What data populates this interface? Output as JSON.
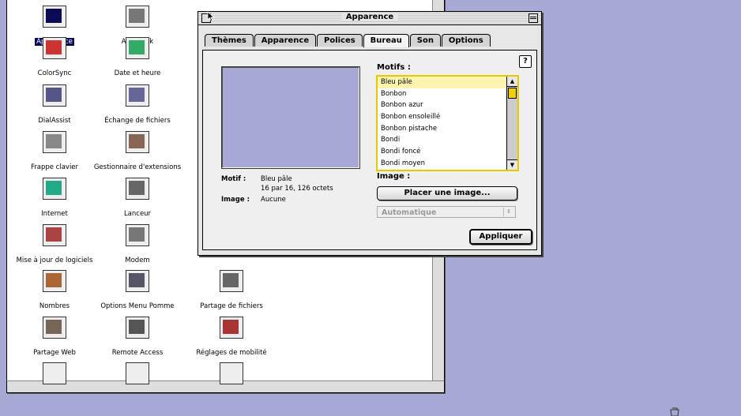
{
  "folder": {
    "icons": [
      {
        "label": "Apparence",
        "icon": "appearance-icon",
        "selected": true
      },
      {
        "label": "AppleTalk",
        "icon": "appletalk-icon"
      },
      {
        "label": "ColorSync",
        "icon": "colorsync-icon"
      },
      {
        "label": "Date et heure",
        "icon": "date-time-icon"
      },
      {
        "label": "DialAssist",
        "icon": "dialassist-icon"
      },
      {
        "label": "Échange de fichiers",
        "icon": "file-exchange-icon"
      },
      {
        "label": "Frappe clavier",
        "icon": "keyboard-icon"
      },
      {
        "label": "Gestionnaire d'extensions",
        "icon": "extensions-manager-icon"
      },
      {
        "label": "Internet",
        "icon": "internet-icon"
      },
      {
        "label": "Lanceur",
        "icon": "launcher-icon"
      },
      {
        "label": "Mise à jour de logiciels",
        "icon": "software-update-icon"
      },
      {
        "label": "Modem",
        "icon": "modem-icon"
      },
      {
        "label": "Nombres",
        "icon": "numbers-icon"
      },
      {
        "label": "Options Menu Pomme",
        "icon": "apple-menu-options-icon"
      },
      {
        "label": "Partage de fichiers",
        "icon": "file-sharing-icon"
      },
      {
        "label": "Partage Web",
        "icon": "web-sharing-icon"
      },
      {
        "label": "Remote Access",
        "icon": "remote-access-icon"
      },
      {
        "label": "Réglages de mobilité",
        "icon": "mobility-icon"
      }
    ]
  },
  "dialog": {
    "title": "Apparence",
    "tabs": [
      "Thèmes",
      "Apparence",
      "Polices",
      "Bureau",
      "Son",
      "Options"
    ],
    "active_tab": "Bureau",
    "motifs_label": "Motifs :",
    "patterns": [
      "Bleu pâle",
      "Bonbon",
      "Bonbon azur",
      "Bonbon ensoleillé",
      "Bonbon pistache",
      "Bondi",
      "Bondi foncé",
      "Bondi moyen"
    ],
    "selected_pattern": "Bleu pâle",
    "info": {
      "motif_key": "Motif :",
      "motif_value": "Bleu pâle",
      "motif_detail": "16 par 16, 126 octets",
      "image_key": "Image :",
      "image_value": "Aucune"
    },
    "image_label": "Image :",
    "place_image_button": "Placer une image...",
    "position_popup": "Automatique",
    "apply_button": "Appliquer",
    "help_label": "?",
    "preview_color": "#a8a8d4"
  }
}
